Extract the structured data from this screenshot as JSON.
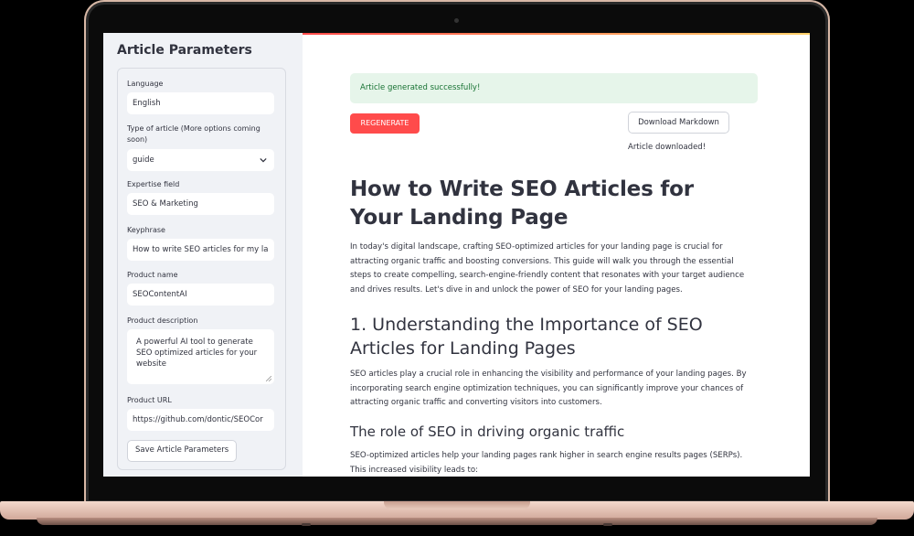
{
  "sidebar": {
    "title": "Article Parameters",
    "fields": {
      "language": {
        "label": "Language",
        "value": "English"
      },
      "article_type": {
        "label": "Type of article (More options coming soon)",
        "value": "guide"
      },
      "expertise": {
        "label": "Expertise field",
        "value": "SEO & Marketing"
      },
      "keyphrase": {
        "label": "Keyphrase",
        "value": "How to write SEO articles for my la"
      },
      "product_name": {
        "label": "Product name",
        "value": "SEOContentAI"
      },
      "product_description": {
        "label": "Product description",
        "value": "A powerful AI tool to generate SEO optimized articles for your website"
      },
      "product_url": {
        "label": "Product URL",
        "value": "https://github.com/dontic/SEOCor"
      }
    },
    "save_label": "Save Article Parameters"
  },
  "main": {
    "alert": "Article generated successfully!",
    "regenerate_label": "REGENERATE",
    "download_label": "Download Markdown",
    "download_status": "Article downloaded!",
    "article": {
      "title": "How to Write SEO Articles for Your Landing Page",
      "intro": "In today's digital landscape, crafting SEO-optimized articles for your landing page is crucial for attracting organic traffic and boosting conversions. This guide will walk you through the essential steps to create compelling, search-engine-friendly content that resonates with your target audience and drives results. Let's dive in and unlock the power of SEO for your landing pages.",
      "h2": "1. Understanding the Importance of SEO Articles for Landing Pages",
      "p2": "SEO articles play a crucial role in enhancing the visibility and performance of your landing pages. By incorporating search engine optimization techniques, you can significantly improve your chances of attracting organic traffic and converting visitors into customers.",
      "h3": "The role of SEO in driving organic traffic",
      "p3": "SEO-optimized articles help your landing pages rank higher in search engine results pages (SERPs). This increased visibility leads to:"
    }
  },
  "colors": {
    "primary": "#ff4b4b",
    "success_bg": "#e6f5ea",
    "success_text": "#177233",
    "sidebar_bg": "#f0f2f6",
    "laptop_frame": "#d8b8a6"
  }
}
